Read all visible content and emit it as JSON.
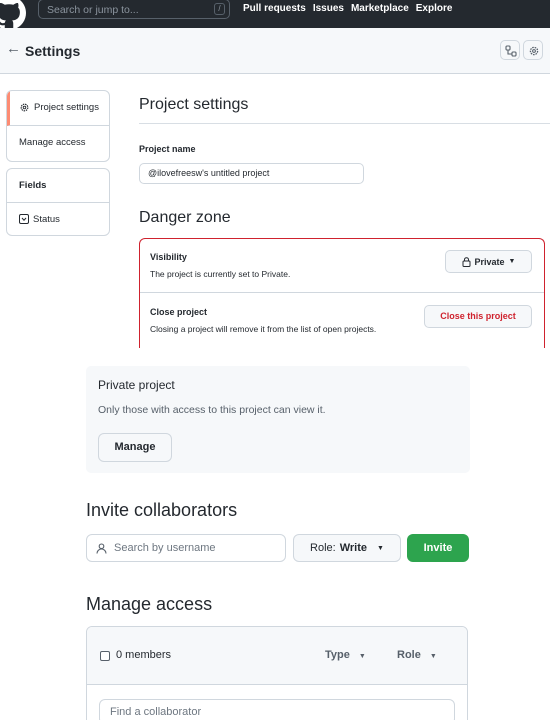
{
  "topnav": {
    "search_placeholder": "Search or jump to...",
    "slash_key": "/",
    "links": [
      "Pull requests",
      "Issues",
      "Marketplace",
      "Explore"
    ]
  },
  "header": {
    "title": "Settings"
  },
  "sidebar": {
    "items": [
      {
        "label": "Project settings",
        "icon": "gear-icon",
        "active": true
      },
      {
        "label": "Manage access"
      }
    ],
    "fields_heading": "Fields",
    "fields": [
      {
        "label": "Status",
        "icon": "single-select-icon"
      }
    ]
  },
  "project_settings": {
    "heading": "Project settings",
    "name_label": "Project name",
    "name_value": "@ilovefreesw's untitled project"
  },
  "danger_zone": {
    "heading": "Danger zone",
    "visibility_title": "Visibility",
    "visibility_desc": "The project is currently set to Private.",
    "visibility_button": "Private",
    "close_title": "Close project",
    "close_desc": "Closing a project will remove it from the list of open projects.",
    "close_button": "Close this project"
  },
  "private_project": {
    "title": "Private project",
    "desc": "Only those with access to this project can view it.",
    "manage_button": "Manage"
  },
  "invite": {
    "heading": "Invite collaborators",
    "search_placeholder": "Search by username",
    "role_label": "Role:",
    "role_value": "Write",
    "invite_button": "Invite"
  },
  "manage_access": {
    "heading": "Manage access",
    "members_count": "0 members",
    "type_label": "Type",
    "role_label": "Role",
    "find_placeholder": "Find a collaborator"
  },
  "colors": {
    "nav_bg": "#24292f",
    "danger": "#cf222e",
    "invite_green": "#2da44e",
    "active_accent": "#fd8c73"
  }
}
